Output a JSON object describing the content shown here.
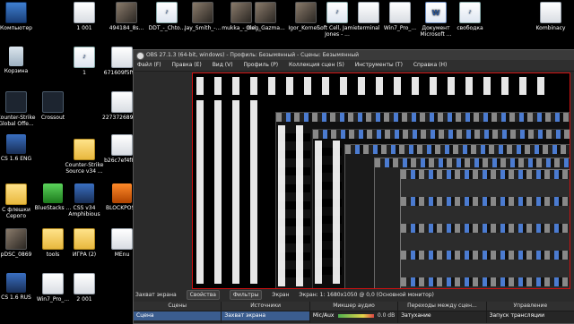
{
  "desktop": {
    "icons": [
      {
        "label": "Компьютер",
        "type": "pc"
      },
      {
        "label": "1 001",
        "type": "doc"
      },
      {
        "label": "494184_8s...",
        "type": "photo"
      },
      {
        "label": "DDT_-_Chto...",
        "type": "mp3"
      },
      {
        "label": "Jay_Smith_-...",
        "type": "photo"
      },
      {
        "label": "mukka_-_Bol...",
        "type": "photo"
      },
      {
        "label": "Oleg_Gazma...",
        "type": "photo"
      },
      {
        "label": "Igor_Kornel...",
        "type": "photo"
      },
      {
        "label": "Soft Cell, Jamie Jones - ...",
        "type": "mp3"
      },
      {
        "label": "terminal",
        "type": "doc"
      },
      {
        "label": "Win7_Pro_...",
        "type": "doc"
      },
      {
        "label": "Документ Microsoft ...",
        "type": "word"
      },
      {
        "label": "свободка",
        "type": "mp3"
      },
      {
        "label": "Kombinacy",
        "type": "doc"
      },
      {
        "label": "Корзина",
        "type": "bin"
      },
      {
        "label": "1",
        "type": "mp3"
      },
      {
        "label": "671609f5f9...",
        "type": "doc"
      },
      {
        "label": "Counter-Strike Global Offe...",
        "type": "cs"
      },
      {
        "label": "Crossout",
        "type": "cs"
      },
      {
        "label": "2273726890...",
        "type": "doc"
      },
      {
        "label": "CS 1.6 ENG",
        "type": "game"
      },
      {
        "label": "b26c7ef4f8...",
        "type": "doc"
      },
      {
        "label": "Counter-Strike Source v34 ...",
        "type": "folder"
      },
      {
        "label": "С флешки Серого",
        "type": "folder"
      },
      {
        "label": "BlueStacks ...",
        "type": "green"
      },
      {
        "label": "CSS v34 Amphibious",
        "type": "game"
      },
      {
        "label": "BLOCKPOST",
        "type": "orange"
      },
      {
        "label": "pDSC_0869",
        "type": "photo"
      },
      {
        "label": "tools",
        "type": "folder"
      },
      {
        "label": "ИГРА (2)",
        "type": "folder"
      },
      {
        "label": "MEnu",
        "type": "doc"
      },
      {
        "label": "CS 1.6 RUS",
        "type": "game"
      },
      {
        "label": "Win7_Pro_...",
        "type": "doc"
      },
      {
        "label": "2 001",
        "type": "doc"
      }
    ]
  },
  "obs": {
    "title": "OBS 27.1.3 (64-bit, windows) - Профиль: Безымянный - Сцены: Безымянный",
    "menu": [
      "Файл (F)",
      "Правка (E)",
      "Вид (V)",
      "Профиль (P)",
      "Коллекция сцен (S)",
      "Инструменты (T)",
      "Справка (H)"
    ],
    "source_bar": {
      "source_name": "Захват экрана",
      "properties": "Свойства",
      "filters": "Фильтры",
      "screen_label": "Экран",
      "screen_value": "Экран: 1: 1680x1050 @ 0,0 (Основной монитор)"
    },
    "docks": [
      {
        "header": "Сцены",
        "rows": [
          "Сцена"
        ]
      },
      {
        "header": "Источники",
        "rows": [
          "Захват экрана"
        ]
      },
      {
        "header": "Микшер аудио",
        "rows": [
          "Mic/Aux"
        ],
        "value": "0.0 dB"
      },
      {
        "header": "Переходы между сцен...",
        "rows": [
          "Затухание"
        ]
      },
      {
        "header": "Управление",
        "rows": [
          "Запуск трансляции"
        ]
      }
    ]
  }
}
